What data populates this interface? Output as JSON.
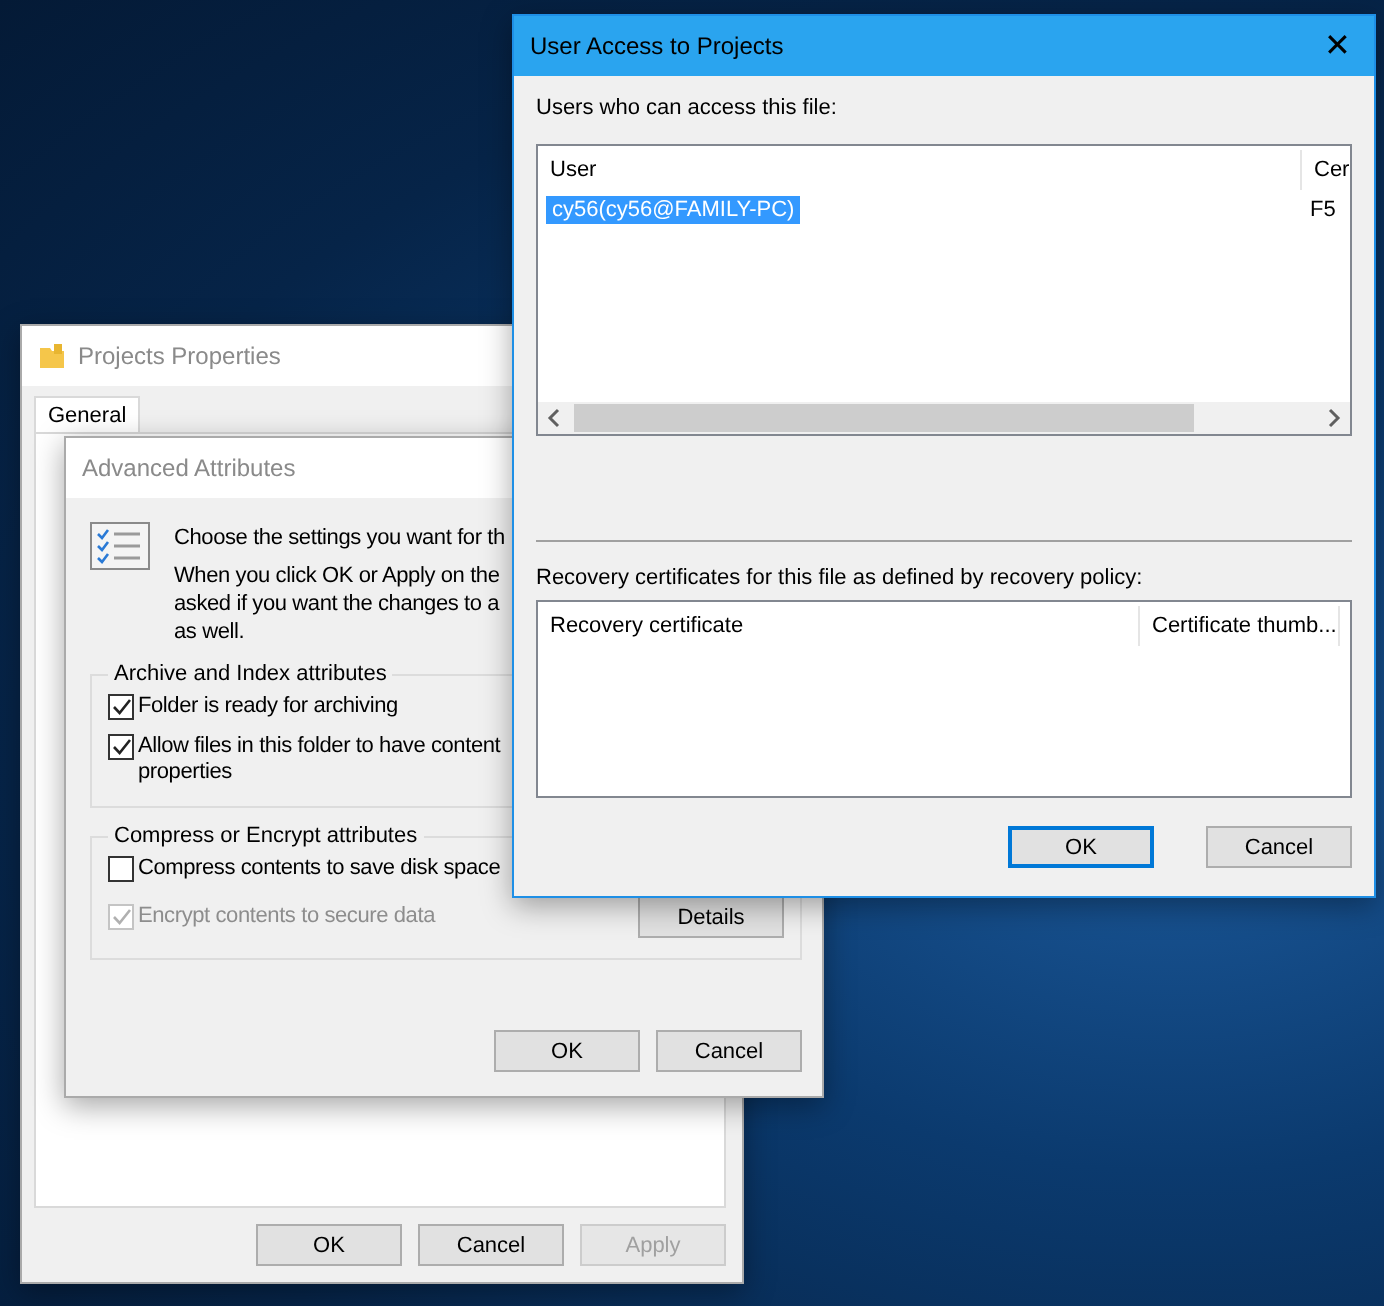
{
  "properties_window": {
    "title": "Projects Properties",
    "active": false,
    "tabs": [
      {
        "label": "General",
        "selected": true
      }
    ],
    "buttons": [
      {
        "label": "OK",
        "disabled": false
      },
      {
        "label": "Cancel",
        "disabled": false
      },
      {
        "label": "Apply",
        "disabled": true
      }
    ]
  },
  "advanced_window": {
    "title": "Advanced Attributes",
    "active": false,
    "intro_heading": "Choose the settings you want for th",
    "intro_lines": [
      "When you click OK or Apply on the",
      "asked if you want the changes to a",
      "as well."
    ],
    "groups": [
      {
        "title": "Archive and Index attributes",
        "options": [
          {
            "lines": [
              "Folder is ready for archiving"
            ],
            "checked": true,
            "disabled": false
          },
          {
            "lines": [
              "Allow files in this folder to have content",
              "properties"
            ],
            "checked": true,
            "disabled": false
          }
        ]
      },
      {
        "title": "Compress or Encrypt attributes",
        "options": [
          {
            "lines": [
              "Compress contents to save disk space"
            ],
            "checked": false,
            "disabled": false
          },
          {
            "lines": [
              "Encrypt contents to secure data"
            ],
            "checked": true,
            "disabled": true
          }
        ],
        "side_button": "Details"
      }
    ],
    "buttons": [
      {
        "label": "OK",
        "focused": false
      },
      {
        "label": "Cancel",
        "focused": false
      }
    ]
  },
  "access_window": {
    "title": "User Access to Projects",
    "active": true,
    "close": "✕",
    "users_label": "Users who can access this file:",
    "users_table": {
      "columns": [
        "User",
        "Cer"
      ],
      "rows": [
        {
          "cells": [
            "cy56(cy56@FAMILY-PC)",
            "F5"
          ],
          "selected": true
        }
      ]
    },
    "recovery_label": "Recovery certificates for this file as defined by recovery policy:",
    "recovery_table": {
      "columns": [
        "Recovery certificate",
        "Certificate thumb..."
      ]
    },
    "buttons": [
      {
        "label": "OK",
        "focused": true
      },
      {
        "label": "Cancel",
        "focused": false
      }
    ]
  }
}
